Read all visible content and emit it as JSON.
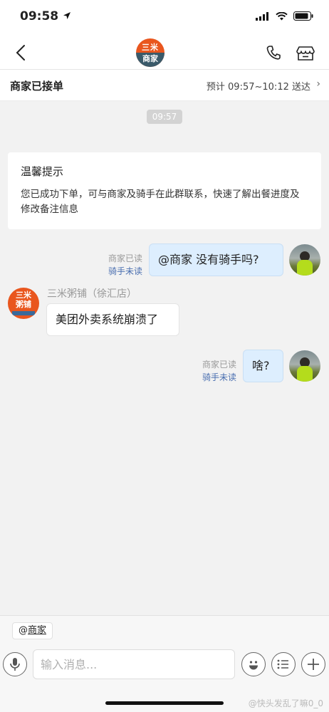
{
  "status_bar": {
    "time": "09:58"
  },
  "header": {
    "merchant_logo_line1": "三米",
    "merchant_logo_line2": "商家"
  },
  "order": {
    "status": "商家已接单",
    "eta": "预计 09:57~10:12 送达"
  },
  "chat": {
    "timestamp": "09:57",
    "tip_title": "温馨提示",
    "tip_body": "您已成功下单，可与商家及骑手在此群联系，快速了解出餐进度及修改备注信息",
    "messages": [
      {
        "from": "me",
        "text": "@商家 没有骑手吗?",
        "merchant_read": "商家已读",
        "rider_read": "骑手未读"
      },
      {
        "from": "shop",
        "sender": "三米粥铺（徐汇店）",
        "text": "美团外卖系统崩溃了"
      },
      {
        "from": "me",
        "text": "啥?",
        "merchant_read": "商家已读",
        "rider_read": "骑手未读"
      }
    ],
    "shop_avatar_line1": "三米",
    "shop_avatar_line2": "粥铺"
  },
  "composer": {
    "mention_prefix": "@",
    "mention_target": "商家",
    "placeholder": "输入消息..."
  },
  "watermark": "@快头发乱了嘛0_0"
}
